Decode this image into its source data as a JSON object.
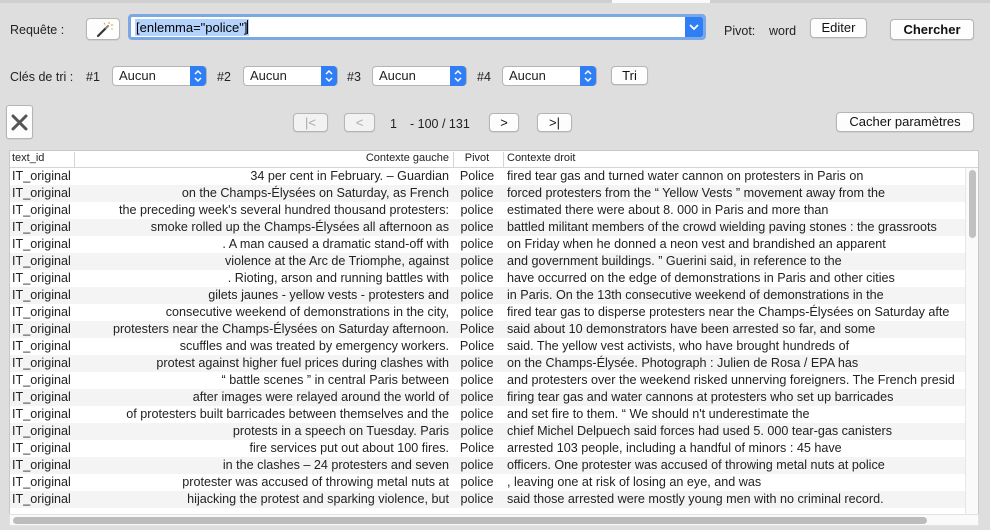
{
  "query": {
    "label": "Requête :",
    "value": "[enlemma=\"police\"]",
    "pivot_label": "Pivot:",
    "pivot_value": "word",
    "edit_button": "Editer",
    "search_button": "Chercher"
  },
  "sort": {
    "label": "Clés de tri :",
    "keys": [
      {
        "n": "#1",
        "value": "Aucun"
      },
      {
        "n": "#2",
        "value": "Aucun"
      },
      {
        "n": "#3",
        "value": "Aucun"
      },
      {
        "n": "#4",
        "value": "Aucun"
      }
    ],
    "sort_button": "Tri"
  },
  "nav": {
    "first": "|<",
    "prev": "<",
    "next": ">",
    "last": ">|",
    "page": "1",
    "range": "- 100 / 131",
    "hide_params": "Cacher paramètres"
  },
  "table": {
    "headers": {
      "id": "text_id",
      "left": "Contexte gauche",
      "pivot": "Pivot",
      "right": "Contexte droit"
    },
    "rows": [
      {
        "id": "IT_original",
        "left": "34 per cent in February. – Guardian",
        "pivot": "Police",
        "right": "fired tear gas and turned water cannon on protesters in Paris on"
      },
      {
        "id": "IT_original",
        "left": "on the Champs-Élysées on Saturday, as French",
        "pivot": "police",
        "right": "forced protesters from the “ Yellow Vests ” movement away from the"
      },
      {
        "id": "IT_original",
        "left": "the preceding week's several hundred thousand protesters:",
        "pivot": "police",
        "right": "estimated there were about 8. 000 in Paris and more than"
      },
      {
        "id": "IT_original",
        "left": "smoke rolled up the Champs-Élysées all afternoon as",
        "pivot": "police",
        "right": "battled militant members of the crowd wielding paving stones : the grassroots"
      },
      {
        "id": "IT_original",
        "left": ". A man caused a dramatic stand-off with",
        "pivot": "police",
        "right": "on Friday when he donned a neon vest and brandished an apparent"
      },
      {
        "id": "IT_original",
        "left": "violence at the Arc de Triomphe, against",
        "pivot": "police",
        "right": "and government buildings. ” Guerini said, in reference to the"
      },
      {
        "id": "IT_original",
        "left": ". Rioting, arson and running battles with",
        "pivot": "police",
        "right": "have occurred on the edge of demonstrations in Paris and other cities"
      },
      {
        "id": "IT_original",
        "left": "gilets jaunes - yellow vests - protesters and",
        "pivot": "police",
        "right": "in Paris. On the 13th consecutive weekend of demonstrations in the"
      },
      {
        "id": "IT_original",
        "left": "consecutive weekend of demonstrations in the city,",
        "pivot": "police",
        "right": "fired tear gas to disperse protesters near the Champs-Élysées on Saturday afte"
      },
      {
        "id": "IT_original",
        "left": "protesters near the Champs-Élysées on Saturday afternoon.",
        "pivot": "Police",
        "right": "said about 10 demonstrators have been arrested so far, and some"
      },
      {
        "id": "IT_original",
        "left": "scuffles and was treated by emergency workers.",
        "pivot": "Police",
        "right": "said. The yellow vest activists, who have brought hundreds of"
      },
      {
        "id": "IT_original",
        "left": "protest against higher fuel prices during clashes with",
        "pivot": "police",
        "right": "on the Champs-Élysée. Photograph : Julien de Rosa / EPA has"
      },
      {
        "id": "IT_original",
        "left": "“ battle scenes ” in central Paris between",
        "pivot": "police",
        "right": "and protesters over the weekend risked unnerving foreigners. The French presid"
      },
      {
        "id": "IT_original",
        "left": "after images were relayed around the world of",
        "pivot": "police",
        "right": "firing tear gas and water cannons at protesters who set up barricades"
      },
      {
        "id": "IT_original",
        "left": "of protesters built barricades between themselves and the",
        "pivot": "police",
        "right": "and set fire to them. “ We should n't underestimate the"
      },
      {
        "id": "IT_original",
        "left": "protests in a speech on Tuesday. Paris",
        "pivot": "police",
        "right": "chief Michel Delpuech said forces had used 5. 000 tear-gas canisters"
      },
      {
        "id": "IT_original",
        "left": "fire services put out about 100 fires.",
        "pivot": "Police",
        "right": "arrested 103 people, including a handful of minors : 45 have"
      },
      {
        "id": "IT_original",
        "left": "in the clashes – 24 protesters and seven",
        "pivot": "police",
        "right": "officers. One protester was accused of throwing metal nuts at police"
      },
      {
        "id": "IT_original",
        "left": "protester was accused of throwing metal nuts at",
        "pivot": "police",
        "right": ", leaving one at risk of losing an eye, and was"
      },
      {
        "id": "IT_original",
        "left": "hijacking the protest and sparking violence, but",
        "pivot": "police",
        "right": "said those arrested were mostly young men with no criminal record."
      }
    ]
  }
}
